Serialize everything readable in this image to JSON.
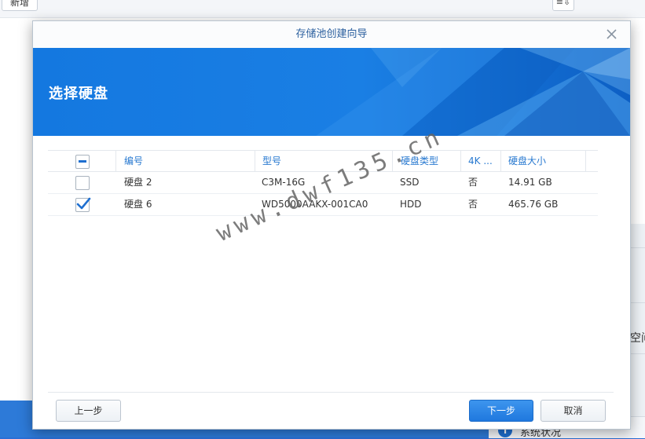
{
  "background": {
    "new_button": "新增",
    "sort_button": "≡⇩",
    "side_label": "空间",
    "widget_label": "系统状况",
    "widget_icon": "info-icon"
  },
  "dialog": {
    "title": "存储池创建向导",
    "close_icon": "close-icon",
    "banner_title": "选择硬盘",
    "accent_color": "#1f78de"
  },
  "table": {
    "columns": [
      "编号",
      "型号",
      "硬盘类型",
      "4K ...",
      "硬盘大小"
    ],
    "rows": [
      {
        "checked": false,
        "id": "硬盘 2",
        "model": "C3M-16G",
        "type": "SSD",
        "k4": "否",
        "size": "14.91 GB"
      },
      {
        "checked": true,
        "id": "硬盘 6",
        "model": "WD5000AAKX-001CA0",
        "type": "HDD",
        "k4": "否",
        "size": "465.76 GB"
      }
    ]
  },
  "watermark": "www.dwf135.cn",
  "footer": {
    "prev_label": "上一步",
    "next_label": "下一步",
    "cancel_label": "取消"
  }
}
